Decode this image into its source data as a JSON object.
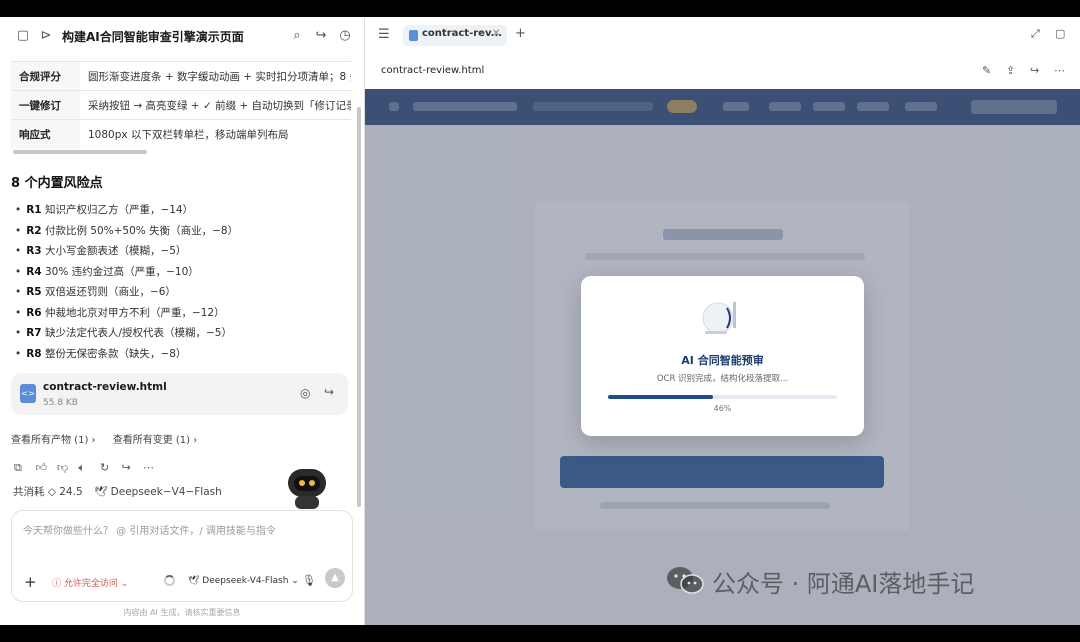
{
  "left": {
    "title": "构建AI合同智能审查引擎演示页面",
    "specs": [
      {
        "key": "合规评分",
        "value": "圆形渐变进度条 + 数字缓动动画 + 实时扣分项清单；8 条"
      },
      {
        "key": "一键修订",
        "value": "采纳按钮 → 高亮变绿 + ✓ 前缀 + 自动切换到「修订记录」"
      },
      {
        "key": "响应式",
        "value": "1080px 以下双栏转单栏，移动端单列布局"
      }
    ],
    "risk_title": "8 个内置风险点",
    "risks": [
      {
        "id": "R1",
        "text": "知识产权归乙方（严重，−14）"
      },
      {
        "id": "R2",
        "text": "付款比例 50%+50% 失衡（商业，−8）"
      },
      {
        "id": "R3",
        "text": "大小写金额表述（模糊，−5）"
      },
      {
        "id": "R4",
        "text": "30% 违约金过高（严重，−10）"
      },
      {
        "id": "R5",
        "text": "双倍返还罚则（商业，−6）"
      },
      {
        "id": "R6",
        "text": "仲裁地北京对甲方不利（严重，−12）"
      },
      {
        "id": "R7",
        "text": "缺少法定代表人/授权代表（模糊，−5）"
      },
      {
        "id": "R8",
        "text": "整份无保密条款（缺失，−8）"
      }
    ],
    "file": {
      "name": "contract-review.html",
      "size": "55.8 KB"
    },
    "links": {
      "artifacts": "查看所有产物 (1) ›",
      "changes": "查看所有变更 (1) ›"
    },
    "usage": {
      "cost": "共消耗 ◇ 24.5",
      "model": "Deepseek−V4−Flash"
    },
    "composer": {
      "placeholder": "今天帮你做些什么？ @ 引用对话文件，/ 调用技能与指令",
      "permission": "允许完全访问 ⌄",
      "model": "Deepseek-V4-Flash ⌄"
    },
    "disclaimer": "内容由 AI 生成，请核实重要信息"
  },
  "right": {
    "tab_label": "contract-rev...",
    "file_name": "contract-review.html",
    "modal": {
      "title": "AI 合同智能预审",
      "subtitle": "OCR 识别完成，结构化段落提取...",
      "progress": 0.46,
      "progress_label": "46%"
    },
    "watermark": "公众号 · 阿通AI落地手记"
  },
  "colors": {
    "brand": "#1f4c8f",
    "danger": "#d9534f",
    "nav": "#1e3d6e"
  }
}
